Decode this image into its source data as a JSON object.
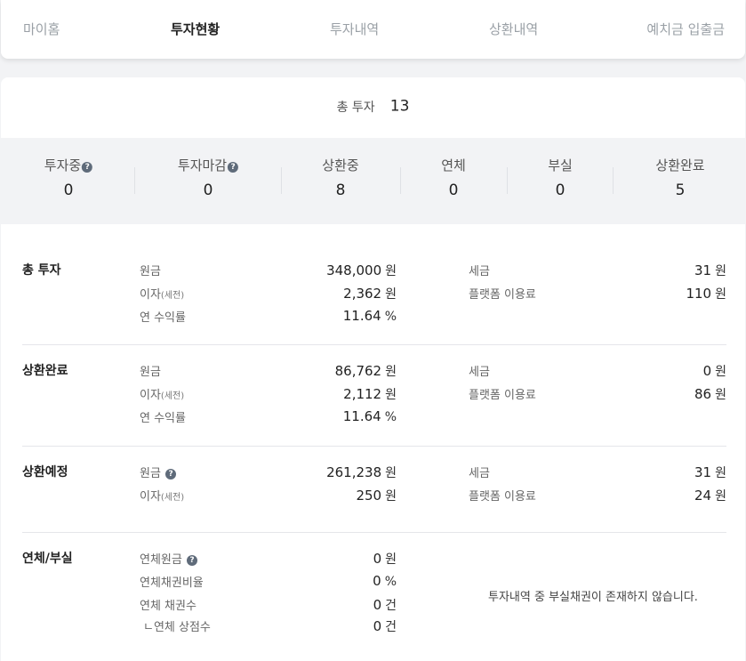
{
  "tabs": [
    {
      "label": "마이홈",
      "active": false
    },
    {
      "label": "투자현황",
      "active": true
    },
    {
      "label": "투자내역",
      "active": false
    },
    {
      "label": "상환내역",
      "active": false
    },
    {
      "label": "예치금 입출금",
      "active": false
    }
  ],
  "summary": {
    "total_label": "총 투자",
    "total_count": "13"
  },
  "status": [
    {
      "label": "투자중",
      "value": "0",
      "help": true
    },
    {
      "label": "투자마감",
      "value": "0",
      "help": true
    },
    {
      "label": "상환중",
      "value": "8"
    },
    {
      "label": "연체",
      "value": "0"
    },
    {
      "label": "부실",
      "value": "0"
    },
    {
      "label": "상환완료",
      "value": "5"
    }
  ],
  "unit_won": "원",
  "unit_pct": "%",
  "unit_count": "건",
  "pretax": "(세전)",
  "sections": {
    "total": {
      "title": "총 투자",
      "principal_label": "원금",
      "principal": "348,000",
      "interest_label": "이자",
      "interest": "2,362",
      "yield_label": "연 수익률",
      "yield": "11.64",
      "tax_label": "세금",
      "tax": "31",
      "fee_label": "플랫폼 이용료",
      "fee": "110"
    },
    "completed": {
      "title": "상환완료",
      "principal_label": "원금",
      "principal": "86,762",
      "interest_label": "이자",
      "interest": "2,112",
      "yield_label": "연 수익률",
      "yield": "11.64",
      "tax_label": "세금",
      "tax": "0",
      "fee_label": "플랫폼 이용료",
      "fee": "86"
    },
    "scheduled": {
      "title": "상환예정",
      "principal_label": "원금",
      "principal": "261,238",
      "interest_label": "이자",
      "interest": "250",
      "tax_label": "세금",
      "tax": "31",
      "fee_label": "플랫폼 이용료",
      "fee": "24"
    },
    "overdue": {
      "title": "연체/부실",
      "principal_label": "연체원금",
      "principal": "0",
      "ratio_label": "연체채권비율",
      "ratio": "0",
      "bonds_label": "연체 채권수",
      "bonds": "0",
      "merchants_label": "ㄴ연체 상점수",
      "merchants": "0",
      "note": "투자내역 중 부실채권이 존재하지 않습니다."
    }
  },
  "colors": {
    "accent_icon": "#5f6b7a",
    "band": "#f2f3f5",
    "muted": "#9aa0a6"
  },
  "icons": {
    "help": "question-circle-icon"
  }
}
